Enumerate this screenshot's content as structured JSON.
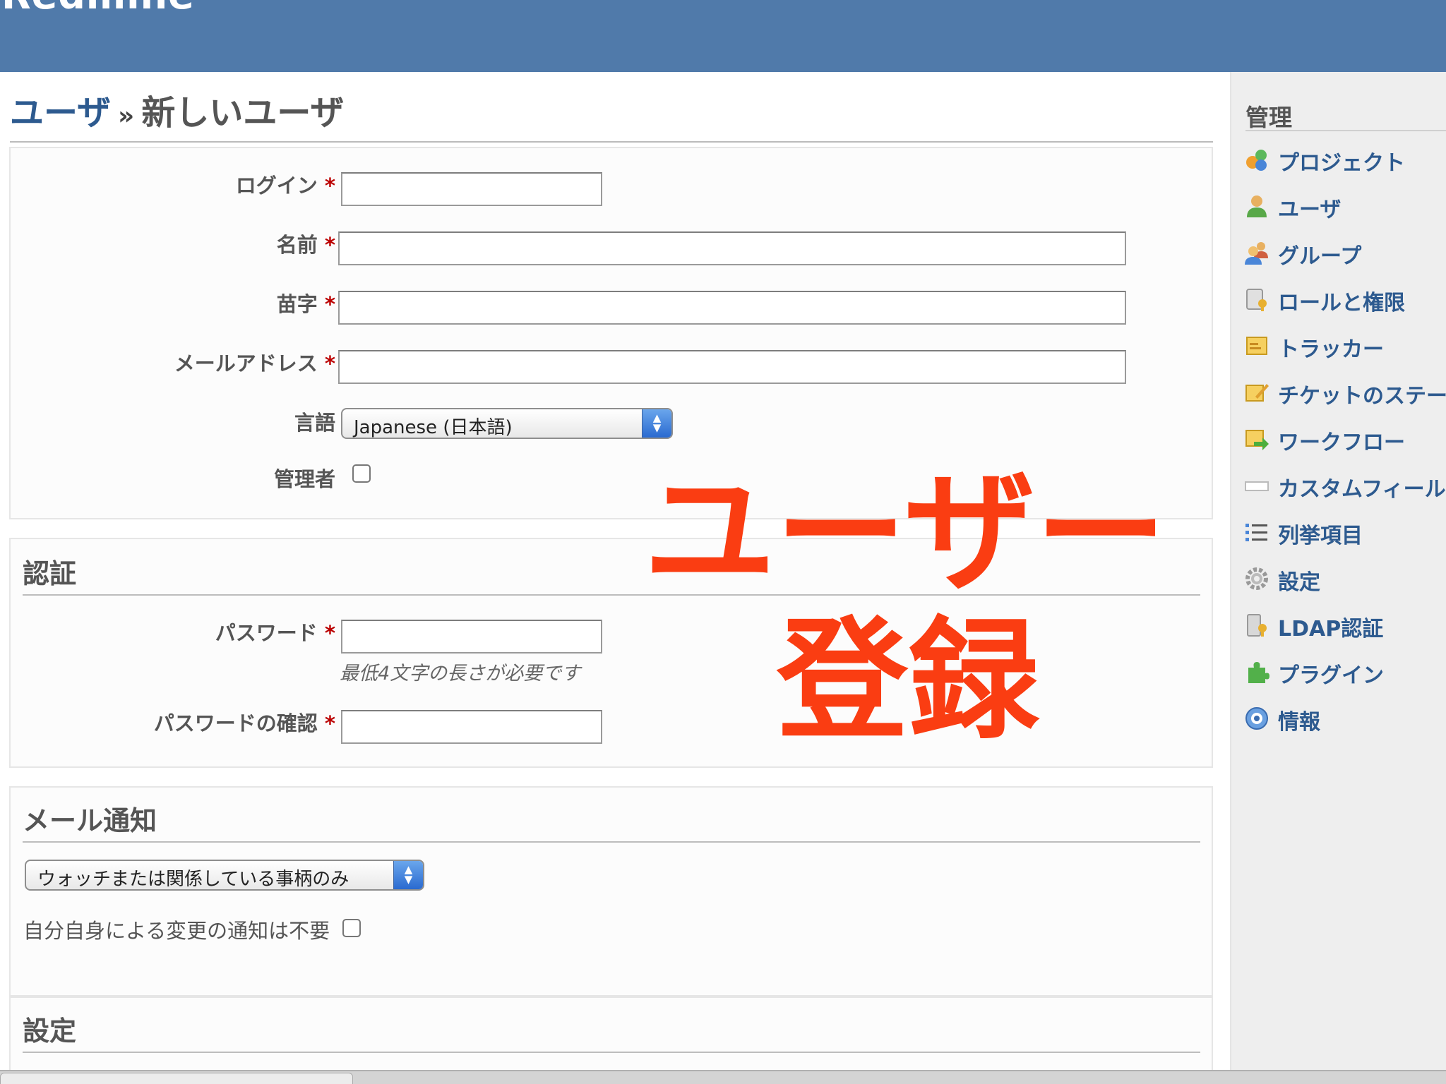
{
  "header": {
    "app_title": "Redmine"
  },
  "page": {
    "breadcrumb_link": "ユーザ",
    "breadcrumb_sep": "»",
    "title": "新しいユーザ"
  },
  "required_mark": "*",
  "account": {
    "login_label": "ログイン",
    "firstname_label": "名前",
    "lastname_label": "苗字",
    "email_label": "メールアドレス",
    "language_label": "言語",
    "language_value": "Japanese (日本語)",
    "admin_label": "管理者"
  },
  "auth": {
    "title": "認証",
    "password_label": "パスワード",
    "password_hint": "最低4文字の長さが必要です",
    "confirm_label": "パスワードの確認"
  },
  "mail": {
    "title": "メール通知",
    "select_value": "ウォッチまたは関係している事柄のみ",
    "no_self_notified_label": "自分自身による変更の通知は不要"
  },
  "settings": {
    "title": "設定"
  },
  "overlay": {
    "line1": "ユーザー",
    "line2": "登録"
  },
  "sidebar": {
    "title": "管理",
    "items": [
      {
        "label": "プロジェクト",
        "icon": "projects-icon"
      },
      {
        "label": "ユーザ",
        "icon": "user-icon"
      },
      {
        "label": "グループ",
        "icon": "group-icon"
      },
      {
        "label": "ロールと権限",
        "icon": "roles-icon"
      },
      {
        "label": "トラッカー",
        "icon": "tracker-icon"
      },
      {
        "label": "チケットのステー",
        "icon": "issue-status-icon"
      },
      {
        "label": "ワークフロー",
        "icon": "workflow-icon"
      },
      {
        "label": "カスタムフィール",
        "icon": "custom-fields-icon"
      },
      {
        "label": "列挙項目",
        "icon": "enumerations-icon"
      },
      {
        "label": "設定",
        "icon": "settings-gear-icon"
      },
      {
        "label": "LDAP認証",
        "icon": "ldap-icon"
      },
      {
        "label": "プラグイン",
        "icon": "plugin-icon"
      },
      {
        "label": "情報",
        "icon": "info-icon"
      }
    ]
  },
  "colors": {
    "header": "#507aaa",
    "link": "#2d5a8f",
    "required": "#bb0000",
    "overlay": "#fa3d12",
    "sidebar_bg": "#eeeeee"
  }
}
